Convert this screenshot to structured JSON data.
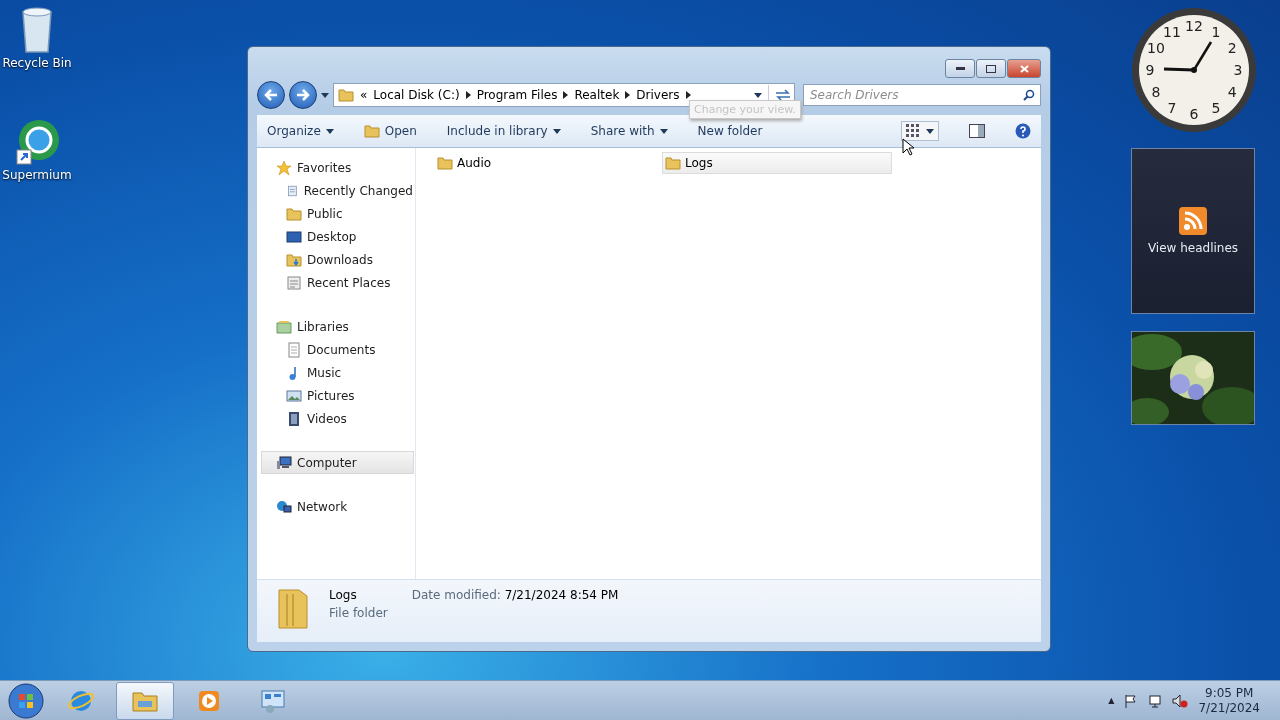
{
  "desktop_icons": [
    {
      "label": "Recycle Bin",
      "kind": "bin"
    },
    {
      "label": "Supermium",
      "kind": "browser"
    }
  ],
  "window": {
    "breadcrumb": [
      "Local Disk (C:)",
      "Program Files",
      "Realtek",
      "Drivers"
    ],
    "overflow": "«",
    "search": {
      "placeholder": "Search Drivers"
    },
    "toolbar": [
      {
        "label": "Organize",
        "kind": "menu"
      },
      {
        "label": "Open",
        "kind": "open"
      },
      {
        "label": "Include in library",
        "kind": "menu"
      },
      {
        "label": "Share with",
        "kind": "menu"
      },
      {
        "label": "New folder",
        "kind": "plain"
      }
    ],
    "tooltip": "Change your view.",
    "nav": [
      {
        "label": "Favorites",
        "kind": "star",
        "selected": false,
        "children": [
          {
            "label": "Recently Changed",
            "kind": "recent",
            "selected": false
          },
          {
            "label": "Public",
            "kind": "folder",
            "selected": false
          },
          {
            "label": "Desktop",
            "kind": "desktop",
            "selected": false
          },
          {
            "label": "Downloads",
            "kind": "downloads",
            "selected": false
          },
          {
            "label": "Recent Places",
            "kind": "places",
            "selected": false
          }
        ]
      },
      {
        "label": "Libraries",
        "kind": "library",
        "selected": false,
        "children": [
          {
            "label": "Documents",
            "kind": "doc",
            "selected": false
          },
          {
            "label": "Music",
            "kind": "music",
            "selected": false
          },
          {
            "label": "Pictures",
            "kind": "pictures",
            "selected": false
          },
          {
            "label": "Videos",
            "kind": "videos",
            "selected": false
          }
        ]
      },
      {
        "label": "Computer",
        "kind": "computer",
        "selected": true
      },
      {
        "label": "Network",
        "kind": "network",
        "selected": false
      }
    ],
    "files": [
      {
        "name": "Audio",
        "selected": false
      },
      {
        "name": "Logs",
        "selected": true
      }
    ],
    "details": {
      "name": "Logs",
      "date_label": "Date modified:",
      "date": "7/21/2024 8:54 PM",
      "type": "File folder"
    }
  },
  "gadgets": {
    "clock": {
      "numerals": [
        "12",
        "11",
        "1",
        "10",
        "2",
        "9",
        "3",
        "8",
        "4",
        "7",
        "5",
        "6"
      ]
    },
    "feed": {
      "label": "View headlines"
    }
  },
  "taskbar": {
    "apps": [
      {
        "kind": "ie",
        "active": false
      },
      {
        "kind": "explorer",
        "active": true
      },
      {
        "kind": "media",
        "active": false
      },
      {
        "kind": "gadgets",
        "active": false
      }
    ],
    "time": "9:05 PM",
    "date": "7/21/2024",
    "tray_arrow": "▲"
  }
}
